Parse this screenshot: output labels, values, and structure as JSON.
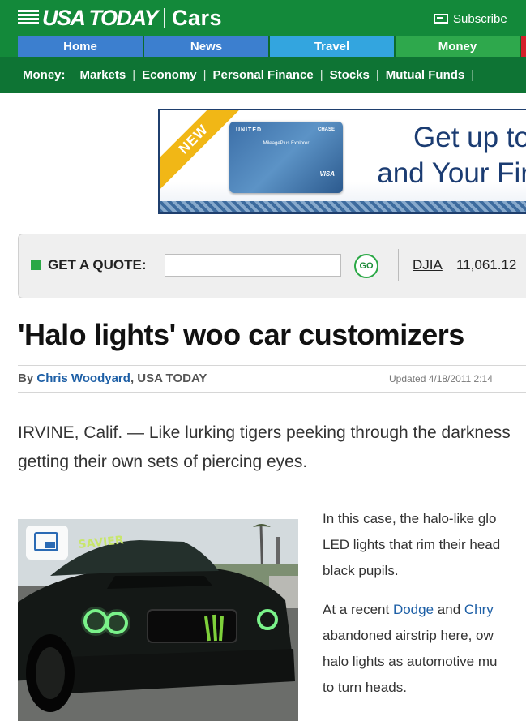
{
  "masthead": {
    "logo": "USA TODAY",
    "section": "Cars",
    "subscribe_label": "Subscribe"
  },
  "nav_tabs": [
    {
      "label": "Home",
      "color": "#3c7fcf"
    },
    {
      "label": "News",
      "color": "#3c7fcf"
    },
    {
      "label": "Travel",
      "color": "#33a5df"
    },
    {
      "label": "Money",
      "color": "#2ea84c"
    }
  ],
  "subnav": {
    "label": "Money:",
    "items": [
      "Markets",
      "Economy",
      "Personal Finance",
      "Stocks",
      "Mutual Funds"
    ]
  },
  "ad": {
    "ribbon": "NEW",
    "card_brand": "UNITED",
    "card_issuer": "CHASE",
    "card_product": "MileagePlus Explorer",
    "card_network": "VISA",
    "headline_line1": "Get up to",
    "headline_line2": "and Your Fir"
  },
  "quote": {
    "label": "GET A QUOTE:",
    "input_value": "",
    "go_label": "GO",
    "index_name": "DJIA",
    "index_value": "11,061.12"
  },
  "article": {
    "headline": "'Halo lights' woo car customizers",
    "byline_prefix": "By",
    "author": "Chris Woodyard",
    "publication": "USA TODAY",
    "updated": "Updated 4/18/2011 2:14",
    "lead_line1": "IRVINE, Calif. — Like lurking tigers peeking through the darkness",
    "lead_line2": "getting their own sets of piercing eyes.",
    "para1_line1": "In this case, the halo-like glo",
    "para1_line2": "LED lights that rim their head",
    "para1_line3": "black pupils.",
    "para2_line1_prefix": "At a recent",
    "para2_link1": "Dodge",
    "para2_and": "and",
    "para2_link2": "Chry",
    "para2_line2": "abandoned airstrip here, ow",
    "para2_line3": "halo lights as automotive mu",
    "para2_line4": "to turn heads.",
    "photo_banner": "SAVIER"
  }
}
